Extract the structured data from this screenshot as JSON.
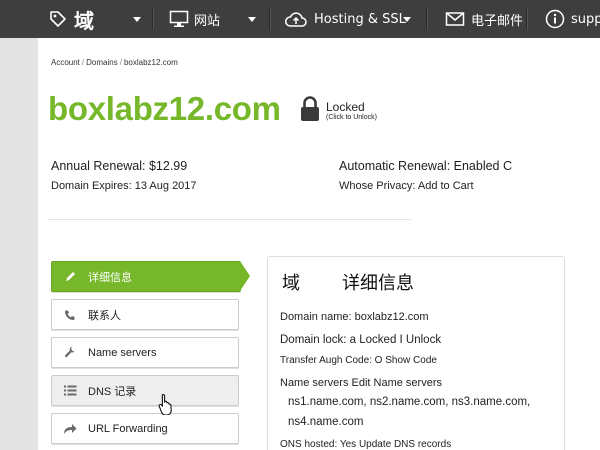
{
  "nav": {
    "domain_label": "域",
    "site_label": "网站",
    "hosting_label": "Hosting & SSL",
    "mail_label": "电子邮件",
    "support_label": "supp"
  },
  "breadcrumb": [
    "Account",
    "Domains",
    "boxlabz12.com"
  ],
  "domain": {
    "name": "boxlabz12.com",
    "lock_status": "Locked",
    "lock_hint": "(Click to Unlock)"
  },
  "summary": {
    "annual_renewal": "Annual Renewal: $12.99",
    "domain_expires": "Domain Expires: 13 Aug 2017",
    "automatic_renewal": "Automatic Renewal: Enabled C",
    "whose_privacy": "Whose Privacy: Add to Cart"
  },
  "tabs": [
    {
      "label": "详细信息",
      "icon": "pencil-icon",
      "active": true
    },
    {
      "label": "联系人",
      "icon": "phone-icon"
    },
    {
      "label": "Name servers",
      "icon": "wrench-icon"
    },
    {
      "label": "DNS 记录",
      "icon": "list-icon",
      "hover": true
    },
    {
      "label": "URL Forwarding",
      "icon": "forward-arrow-icon"
    }
  ],
  "details": {
    "title_a": "域",
    "title_b": "详细信息",
    "domain_name": "Domain name: boxlabz12.com",
    "domain_lock": "Domain lock: a Locked I Unlock",
    "transfer_code": "Transfer Augh Code: O Show Code",
    "name_servers": "Name servers Edit Name servers",
    "ns_line1": "ns1.name.com, ns2.name.com, ns3.name.com,",
    "ns_line2": "ns4.name.com",
    "dns_hosted": "ONS hosted: Yes Update DNS records"
  },
  "colors": {
    "accent_green": "#76b82a",
    "nav_bg": "#3e3e3e"
  }
}
